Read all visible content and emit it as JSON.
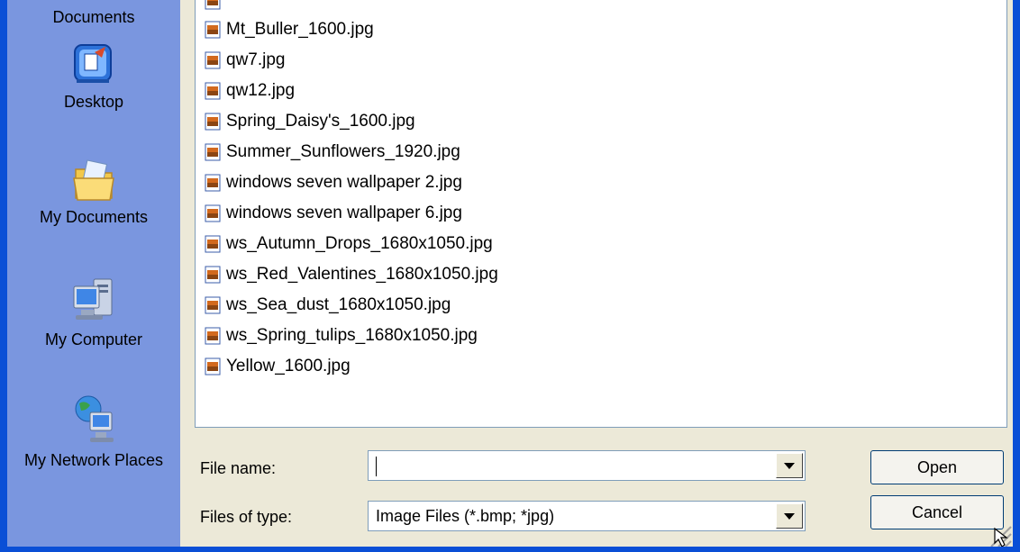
{
  "places": [
    {
      "label": "Documents",
      "icon": "recent-documents-icon"
    },
    {
      "label": "Desktop",
      "icon": "desktop-icon"
    },
    {
      "label": "My Documents",
      "icon": "my-documents-folder-icon"
    },
    {
      "label": "My Computer",
      "icon": "my-computer-icon"
    },
    {
      "label": "My Network Places",
      "icon": "my-network-places-icon"
    }
  ],
  "files": [
    "Mt_Buller_1600.jpg",
    "qw7.jpg",
    "qw12.jpg",
    "Spring_Daisy's_1600.jpg",
    "Summer_Sunflowers_1920.jpg",
    "windows seven wallpaper 2.jpg",
    "windows seven wallpaper 6.jpg",
    "ws_Autumn_Drops_1680x1050.jpg",
    "ws_Red_Valentines_1680x1050.jpg",
    "ws_Sea_dust_1680x1050.jpg",
    "ws_Spring_tulips_1680x1050.jpg",
    "Yellow_1600.jpg"
  ],
  "file_name": {
    "label": "File name:",
    "value": ""
  },
  "file_type": {
    "label": "Files of type:",
    "value": "Image Files (*.bmp; *jpg)"
  },
  "buttons": {
    "open": "Open",
    "cancel": "Cancel"
  },
  "colors": {
    "window_border": "#0a4fd6",
    "places_bg": "#7a96df",
    "dialog_bg": "#ece9d8"
  }
}
